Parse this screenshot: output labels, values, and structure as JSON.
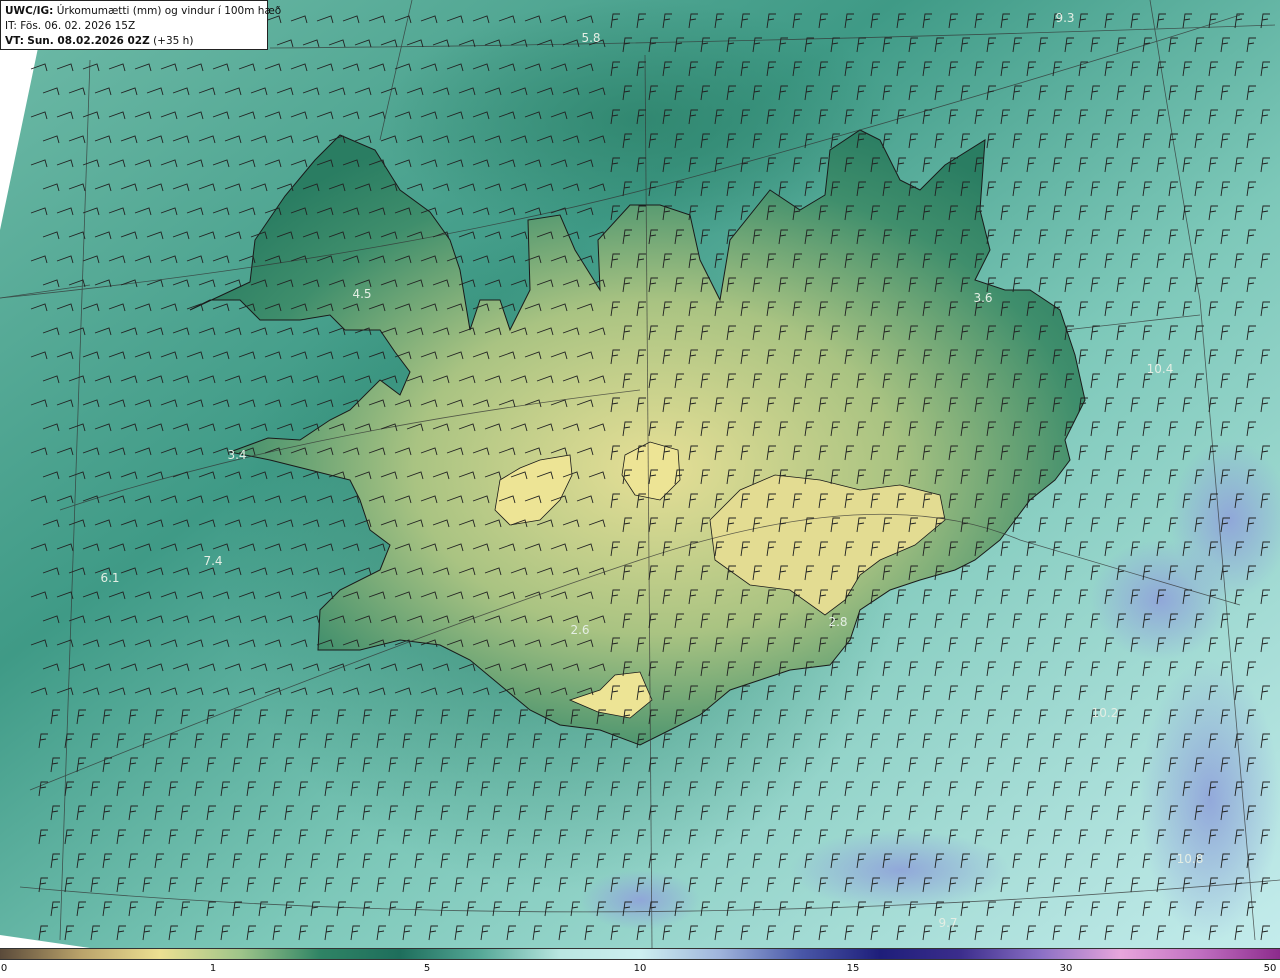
{
  "header": {
    "model": "UWC/IG:",
    "product": "Úrkomumætti (mm) og vindur í 100m hæð",
    "init_time": "IT: Fös. 06. 02. 2026 15Z",
    "valid_prefix": "VT:",
    "valid_time": "Sun. 08.02.2026 02Z",
    "lead_time": "(+35 h)"
  },
  "map_labels": [
    {
      "text": "5.8"
    },
    {
      "text": "9.3"
    },
    {
      "text": "4.5"
    },
    {
      "text": "3.6"
    },
    {
      "text": "3.4"
    },
    {
      "text": "6.1"
    },
    {
      "text": "7.4"
    },
    {
      "text": "2.6"
    },
    {
      "text": "2.8"
    },
    {
      "text": "10.4"
    },
    {
      "text": "10.2"
    },
    {
      "text": "10.8"
    },
    {
      "text": "9.7"
    }
  ],
  "colorbar": {
    "ticks": [
      "0",
      "1",
      "5",
      "10",
      "15",
      "30",
      "50"
    ],
    "colors": [
      "#5a4a3a",
      "#b9a26a",
      "#ece092",
      "#9fc58a",
      "#2f8465",
      "#1e6e5c",
      "#55a897",
      "#b9e6e1",
      "#cdeff0",
      "#9fb4dc",
      "#4a58a8",
      "#1e1e7a",
      "#3b2d8c",
      "#8a6fc4",
      "#e7a6dc",
      "#c06fc1",
      "#8c2b8c"
    ]
  },
  "colors": {
    "sea_base": "#7fc9bb",
    "land_high": "#e9e39a",
    "land_mid": "#2e8b6a",
    "coastline": "#1a1a1a",
    "barb": "#222222"
  }
}
